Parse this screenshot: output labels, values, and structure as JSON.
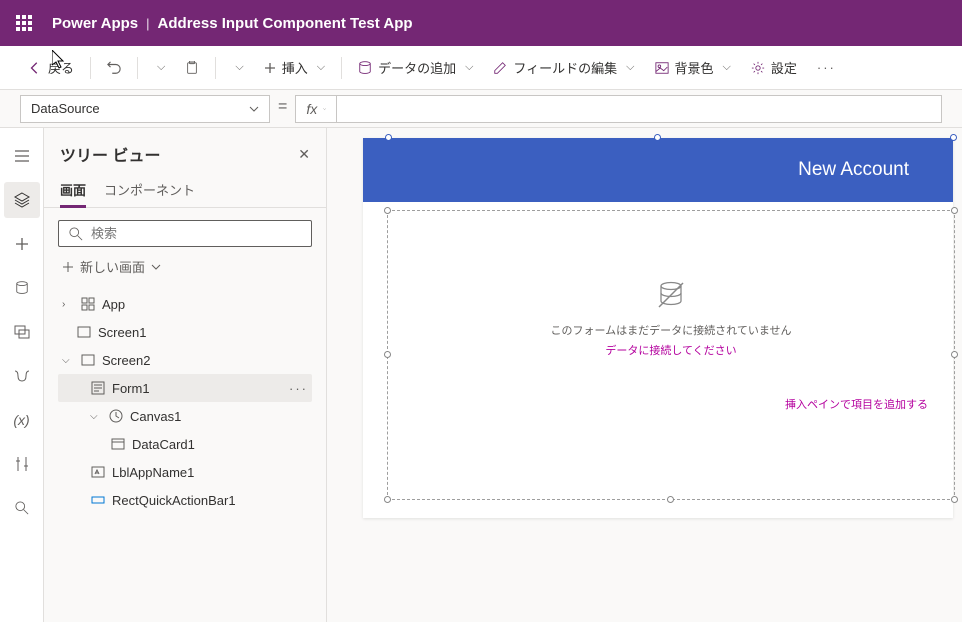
{
  "header": {
    "product": "Power Apps",
    "app_name": "Address Input Component Test App"
  },
  "toolbar": {
    "back": "戻る",
    "insert": "挿入",
    "add_data": "データの追加",
    "edit_fields": "フィールドの編集",
    "background": "背景色",
    "settings": "設定"
  },
  "formula": {
    "property": "DataSource",
    "fx": "fx",
    "value": ""
  },
  "tree": {
    "title": "ツリー ビュー",
    "tabs": {
      "screens": "画面",
      "components": "コンポーネント"
    },
    "search_placeholder": "検索",
    "new_screen": "新しい画面",
    "items": {
      "app": "App",
      "screen1": "Screen1",
      "screen2": "Screen2",
      "form1": "Form1",
      "canvas1": "Canvas1",
      "datacard1": "DataCard1",
      "lblappname1": "LblAppName1",
      "rectquick": "RectQuickActionBar1"
    }
  },
  "canvas": {
    "header_title": "New Account",
    "form_empty": {
      "line1": "このフォームはまだデータに接続されていません",
      "link_connect": "データに接続してください",
      "link_insert": "挿入ペインで項目を追加する"
    }
  }
}
